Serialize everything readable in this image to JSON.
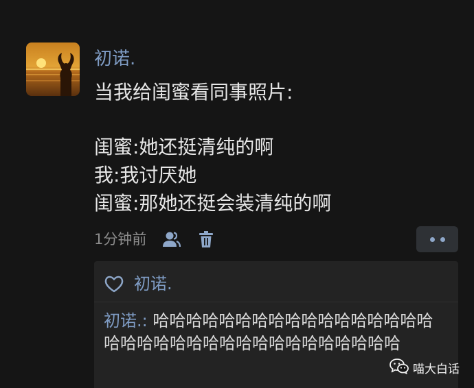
{
  "post": {
    "author": "初诺.",
    "lines": [
      "当我给闺蜜看同事照片:",
      "",
      "闺蜜:她还挺清纯的啊",
      "我:我讨厌她",
      "闺蜜:那她还挺会装清纯的啊"
    ],
    "time": "1分钟前"
  },
  "likes": {
    "names": "初诺."
  },
  "comment": {
    "author": "初诺.:",
    "text": " 哈哈哈哈哈哈哈哈哈哈哈哈哈哈哈哈哈哈哈哈哈哈哈哈哈哈哈哈哈哈哈哈哈哈哈"
  },
  "watermark": {
    "text": "喵大白话"
  },
  "colors": {
    "background": "#151515",
    "name_blue": "#7f9cc4",
    "text": "#e6e6e6",
    "muted": "#8c8c8c",
    "panel": "#232323"
  },
  "icons": [
    "friends-icon",
    "trash-icon",
    "more-dots-icon",
    "heart-icon",
    "wechat-icon"
  ]
}
